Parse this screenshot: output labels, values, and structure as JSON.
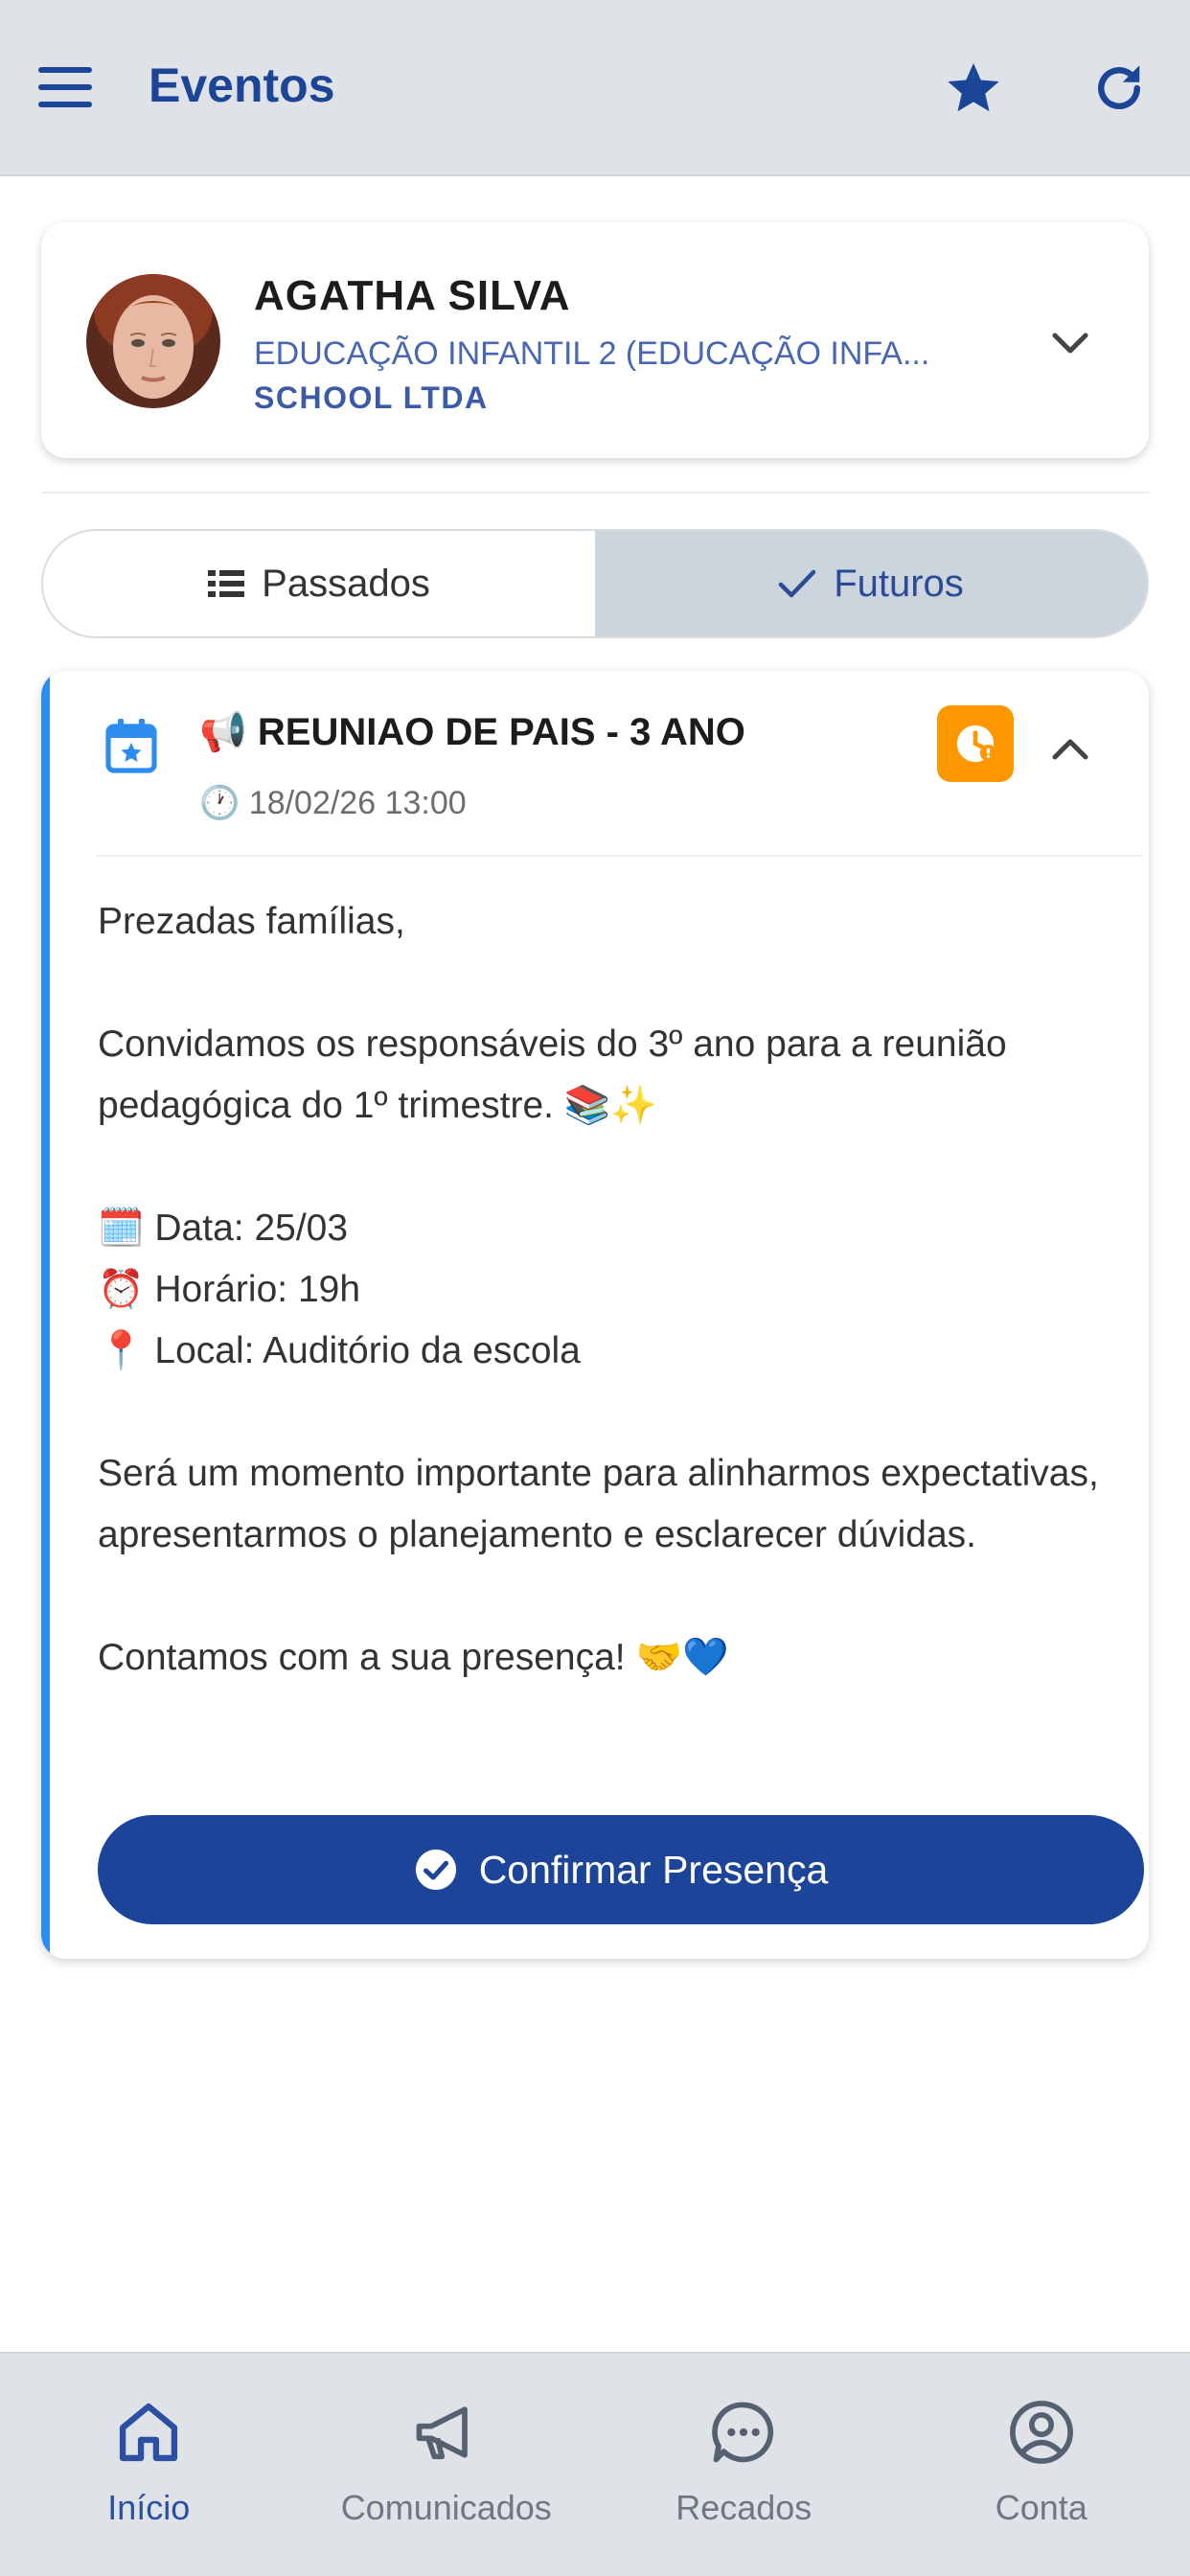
{
  "header": {
    "title": "Eventos",
    "menu_icon": "menu-icon",
    "favorite_icon": "star-icon",
    "refresh_icon": "refresh-icon"
  },
  "student": {
    "name": "AGATHA SILVA",
    "class": "EDUCAÇÃO INFANTIL 2 (EDUCAÇÃO INFA...",
    "school": "SCHOOL LTDA"
  },
  "tabs": [
    {
      "label": "Passados",
      "icon": "list-icon",
      "active": false
    },
    {
      "label": "Futuros",
      "icon": "check-icon",
      "active": true
    }
  ],
  "event": {
    "title": "📢 REUNIAO DE PAIS - 3 ANO",
    "datetime": "🕐 18/02/26 13:00",
    "status_icon": "clock-pending-icon",
    "status_color": "#ff9800",
    "accent_color": "#2d8cf0",
    "body": [
      "Prezadas famílias,",
      "Convidamos os responsáveis do 3º ano para a reunião pedagógica do 1º trimestre. 📚✨",
      "🗓️ Data: 25/03\n⏰ Horário: 19h\n📍 Local: Auditório da escola",
      "Será um momento importante para alinharmos expectativas, apresentarmos o planejamento e esclarecer dúvidas.",
      "Contamos com a sua presença! 🤝💙"
    ],
    "confirm_label": "Confirmar Presença"
  },
  "bottom_nav": [
    {
      "label": "Início",
      "icon": "home-icon",
      "active": true
    },
    {
      "label": "Comunicados",
      "icon": "megaphone-icon",
      "active": false
    },
    {
      "label": "Recados",
      "icon": "chat-icon",
      "active": false
    },
    {
      "label": "Conta",
      "icon": "account-icon",
      "active": false
    }
  ],
  "colors": {
    "primary": "#1c459a",
    "bar_background": "#dfe3e7",
    "pending": "#ff9800"
  }
}
